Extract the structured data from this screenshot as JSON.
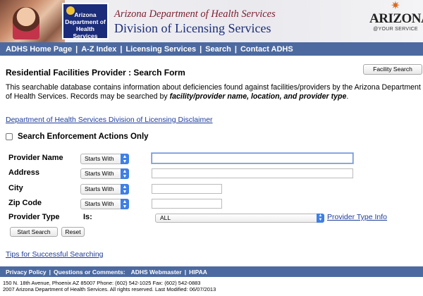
{
  "header": {
    "logo_line1": "Arizona",
    "logo_line2": "Department of",
    "logo_line3": "Health Services",
    "title_agency": "Arizona Department of Health Services",
    "title_division": "Division of Licensing Services",
    "az_logo": "ARIZONA",
    "az_tagline": "@YOUR SERVICE"
  },
  "nav": {
    "items": [
      "ADHS Home Page",
      "A-Z Index",
      "Licensing Services",
      "Search",
      "Contact ADHS"
    ]
  },
  "main": {
    "page_title": "Residential Facilities Provider : Search Form",
    "facility_search_button": "Facility Search",
    "intro_text": "This searchable database contains information about deficiencies found against facilities/providers by the Arizona Department of Health Services. Records may be searched by ",
    "intro_emphasis": "facility/provider name, location, and provider type",
    "intro_end": ".",
    "disclaimer_link": "Department of Health Services Division of Licensing Disclaimer",
    "enforcement_label": "Search Enforcement Actions Only",
    "fields": {
      "provider_name": {
        "label": "Provider Name",
        "mode": "Starts With",
        "value": ""
      },
      "address": {
        "label": "Address",
        "mode": "Starts With",
        "value": ""
      },
      "city": {
        "label": "City",
        "mode": "Starts With",
        "value": ""
      },
      "zip_code": {
        "label": "Zip Code",
        "mode": "Starts With",
        "value": ""
      },
      "provider_type": {
        "label": "Provider Type",
        "is_label": "Is:",
        "value": "ALL",
        "info_link": "Provider Type Info"
      }
    },
    "start_search_button": "Start Search",
    "reset_button": "Reset",
    "tips_link": "Tips for Successful Searching"
  },
  "footer": {
    "privacy": "Privacy Policy",
    "questions": "Questions or Comments:",
    "webmaster": "ADHS Webmaster",
    "hipaa": "HIPAA",
    "address_line": "150 N. 18th Avenue, Phoenix AZ 85007 Phone: (602) 542-1025 Fax: (602) 542-0883",
    "copyright_line": "2007 Arizona Department of Health Services. All rights reserved. Last Modified: 06/07/2013"
  },
  "colors": {
    "nav_bar": "#4d6aa0",
    "link": "#1e3c9a",
    "select_arrow": "#3f7fe6"
  }
}
